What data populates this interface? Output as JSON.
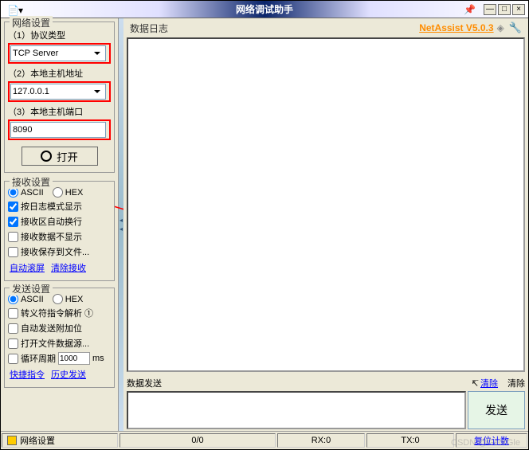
{
  "title": "网络调试助手",
  "brand": "NetAssist V5.0.3",
  "sidebar": {
    "group1": {
      "title": "网络设置",
      "protocol_label": "（1）协议类型",
      "protocol_value": "TCP Server",
      "host_label": "（2）本地主机地址",
      "host_value": "127.0.0.1",
      "port_label": "（3）本地主机端口",
      "port_value": "8090",
      "open_btn": "打开"
    },
    "group2": {
      "title": "接收设置",
      "ascii": "ASCII",
      "hex": "HEX",
      "opt1": "按日志模式显示",
      "opt2": "接收区自动换行",
      "opt3": "接收数据不显示",
      "opt4": "接收保存到文件...",
      "link1": "自动滚屏",
      "link2": "清除接收"
    },
    "group3": {
      "title": "发送设置",
      "ascii": "ASCII",
      "hex": "HEX",
      "opt1": "转义符指令解析 ①",
      "opt2": "自动发送附加位",
      "opt3": "打开文件数据源...",
      "opt4_a": "循环周期",
      "opt4_val": "1000",
      "opt4_b": "ms",
      "link1": "快捷指令",
      "link2": "历史发送"
    }
  },
  "main": {
    "log_title": "数据日志",
    "send_title": "数据发送",
    "clear_link": "清除",
    "clear_btn": "清除",
    "send_btn": "发送"
  },
  "statusbar": {
    "label": "网络设置",
    "stat1": "0/0",
    "stat2": "RX:0",
    "stat3": "TX:0",
    "stat4": "复位计数"
  },
  "watermark": "CSDN @GeorGle"
}
